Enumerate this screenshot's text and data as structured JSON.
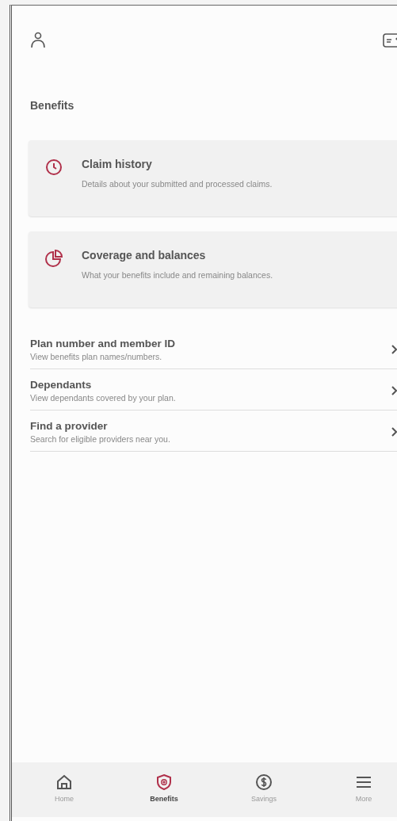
{
  "page_title": "Benefits",
  "cards": [
    {
      "kind": "clock",
      "title": "Claim history",
      "description": "Details about your submitted and processed claims."
    },
    {
      "kind": "pie",
      "title": "Coverage and balances",
      "description": "What your benefits include and remaining balances."
    }
  ],
  "links": [
    {
      "title": "Plan number and member ID",
      "description": "View benefits plan names/numbers."
    },
    {
      "title": "Dependants",
      "description": "View dependants covered by your plan."
    },
    {
      "title": "Find a provider",
      "description": "Search for eligible providers near you."
    }
  ],
  "nav": [
    {
      "kind": "home",
      "label": "Home",
      "selected": false
    },
    {
      "kind": "shield",
      "label": "Benefits",
      "selected": true
    },
    {
      "kind": "dollar",
      "label": "Savings",
      "selected": false
    },
    {
      "kind": "menu",
      "label": "More",
      "selected": false
    }
  ]
}
